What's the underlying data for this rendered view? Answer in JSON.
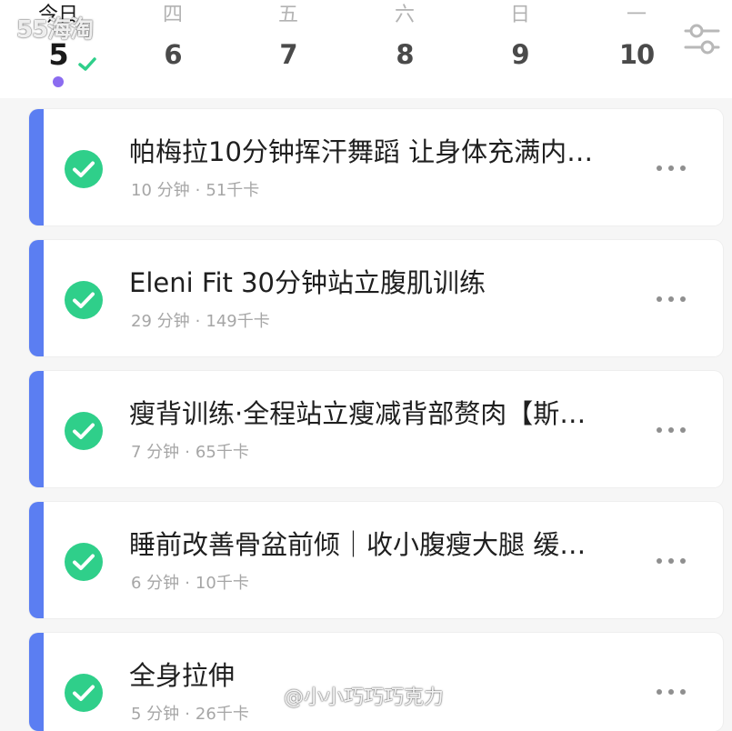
{
  "week": {
    "days": [
      {
        "weekday": "今日",
        "date": "5",
        "today": true
      },
      {
        "weekday": "四",
        "date": "6"
      },
      {
        "weekday": "五",
        "date": "7"
      },
      {
        "weekday": "六",
        "date": "8"
      },
      {
        "weekday": "日",
        "date": "9"
      },
      {
        "weekday": "一",
        "date": "10"
      }
    ],
    "filter_icon": "sliders-icon"
  },
  "colors": {
    "accent": "#5b7ef2",
    "check_green": "#2fcf8a",
    "today_dot": "#8b6cf0"
  },
  "workouts": [
    {
      "title": "帕梅拉10分钟挥汗舞蹈 让身体充满内…",
      "duration": "10 分钟",
      "calories": "51千卡"
    },
    {
      "title": "Eleni Fit 30分钟站立腹肌训练",
      "duration": "29 分钟",
      "calories": "149千卡"
    },
    {
      "title": "瘦背训练·全程站立瘦减背部赘肉【斯…",
      "duration": "7 分钟",
      "calories": "65千卡"
    },
    {
      "title": "睡前改善骨盆前倾｜收小腹瘦大腿 缓…",
      "duration": "6 分钟",
      "calories": "10千卡"
    },
    {
      "title": "全身拉伸",
      "duration": "5 分钟",
      "calories": "26千卡"
    }
  ],
  "meta_separator": "·",
  "watermarks": {
    "top": "55海淘",
    "bottom": "@小小巧巧巧克力"
  }
}
